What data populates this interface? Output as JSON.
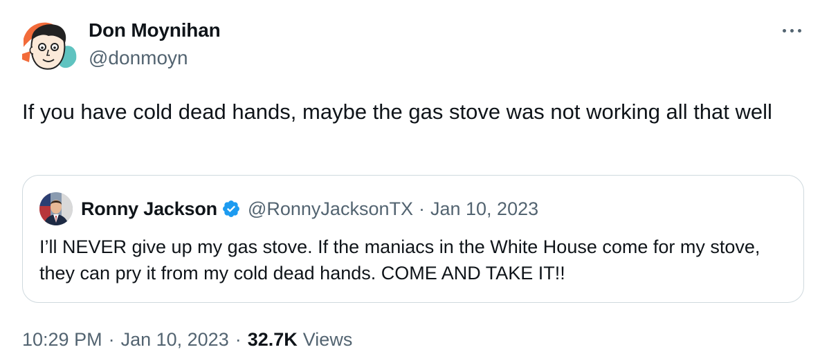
{
  "author": {
    "name": "Don Moynihan",
    "handle": "@donmoyn",
    "avatar_icon": "cartoon-face-avatar"
  },
  "more_icon": "more-horizontal-icon",
  "tweet": {
    "text": "If you have cold dead hands, maybe the gas stove was not working all that well"
  },
  "quoted": {
    "name": "Ronny Jackson",
    "verified_icon": "verified-badge-icon",
    "handle": "@RonnyJacksonTX",
    "separator": "·",
    "date": "Jan 10, 2023",
    "text": "I’ll NEVER give up my gas stove. If the maniacs in the White House come for my stove, they can pry it from my cold dead hands. COME AND TAKE IT!!"
  },
  "meta": {
    "time": "10:29 PM",
    "separator": "·",
    "date": "Jan 10, 2023",
    "views_count": "32.7K",
    "views_label": "Views"
  },
  "colors": {
    "primary_text": "#0f1419",
    "secondary_text": "#536471",
    "border": "#cfd9de",
    "verified": "#1d9bf0"
  }
}
